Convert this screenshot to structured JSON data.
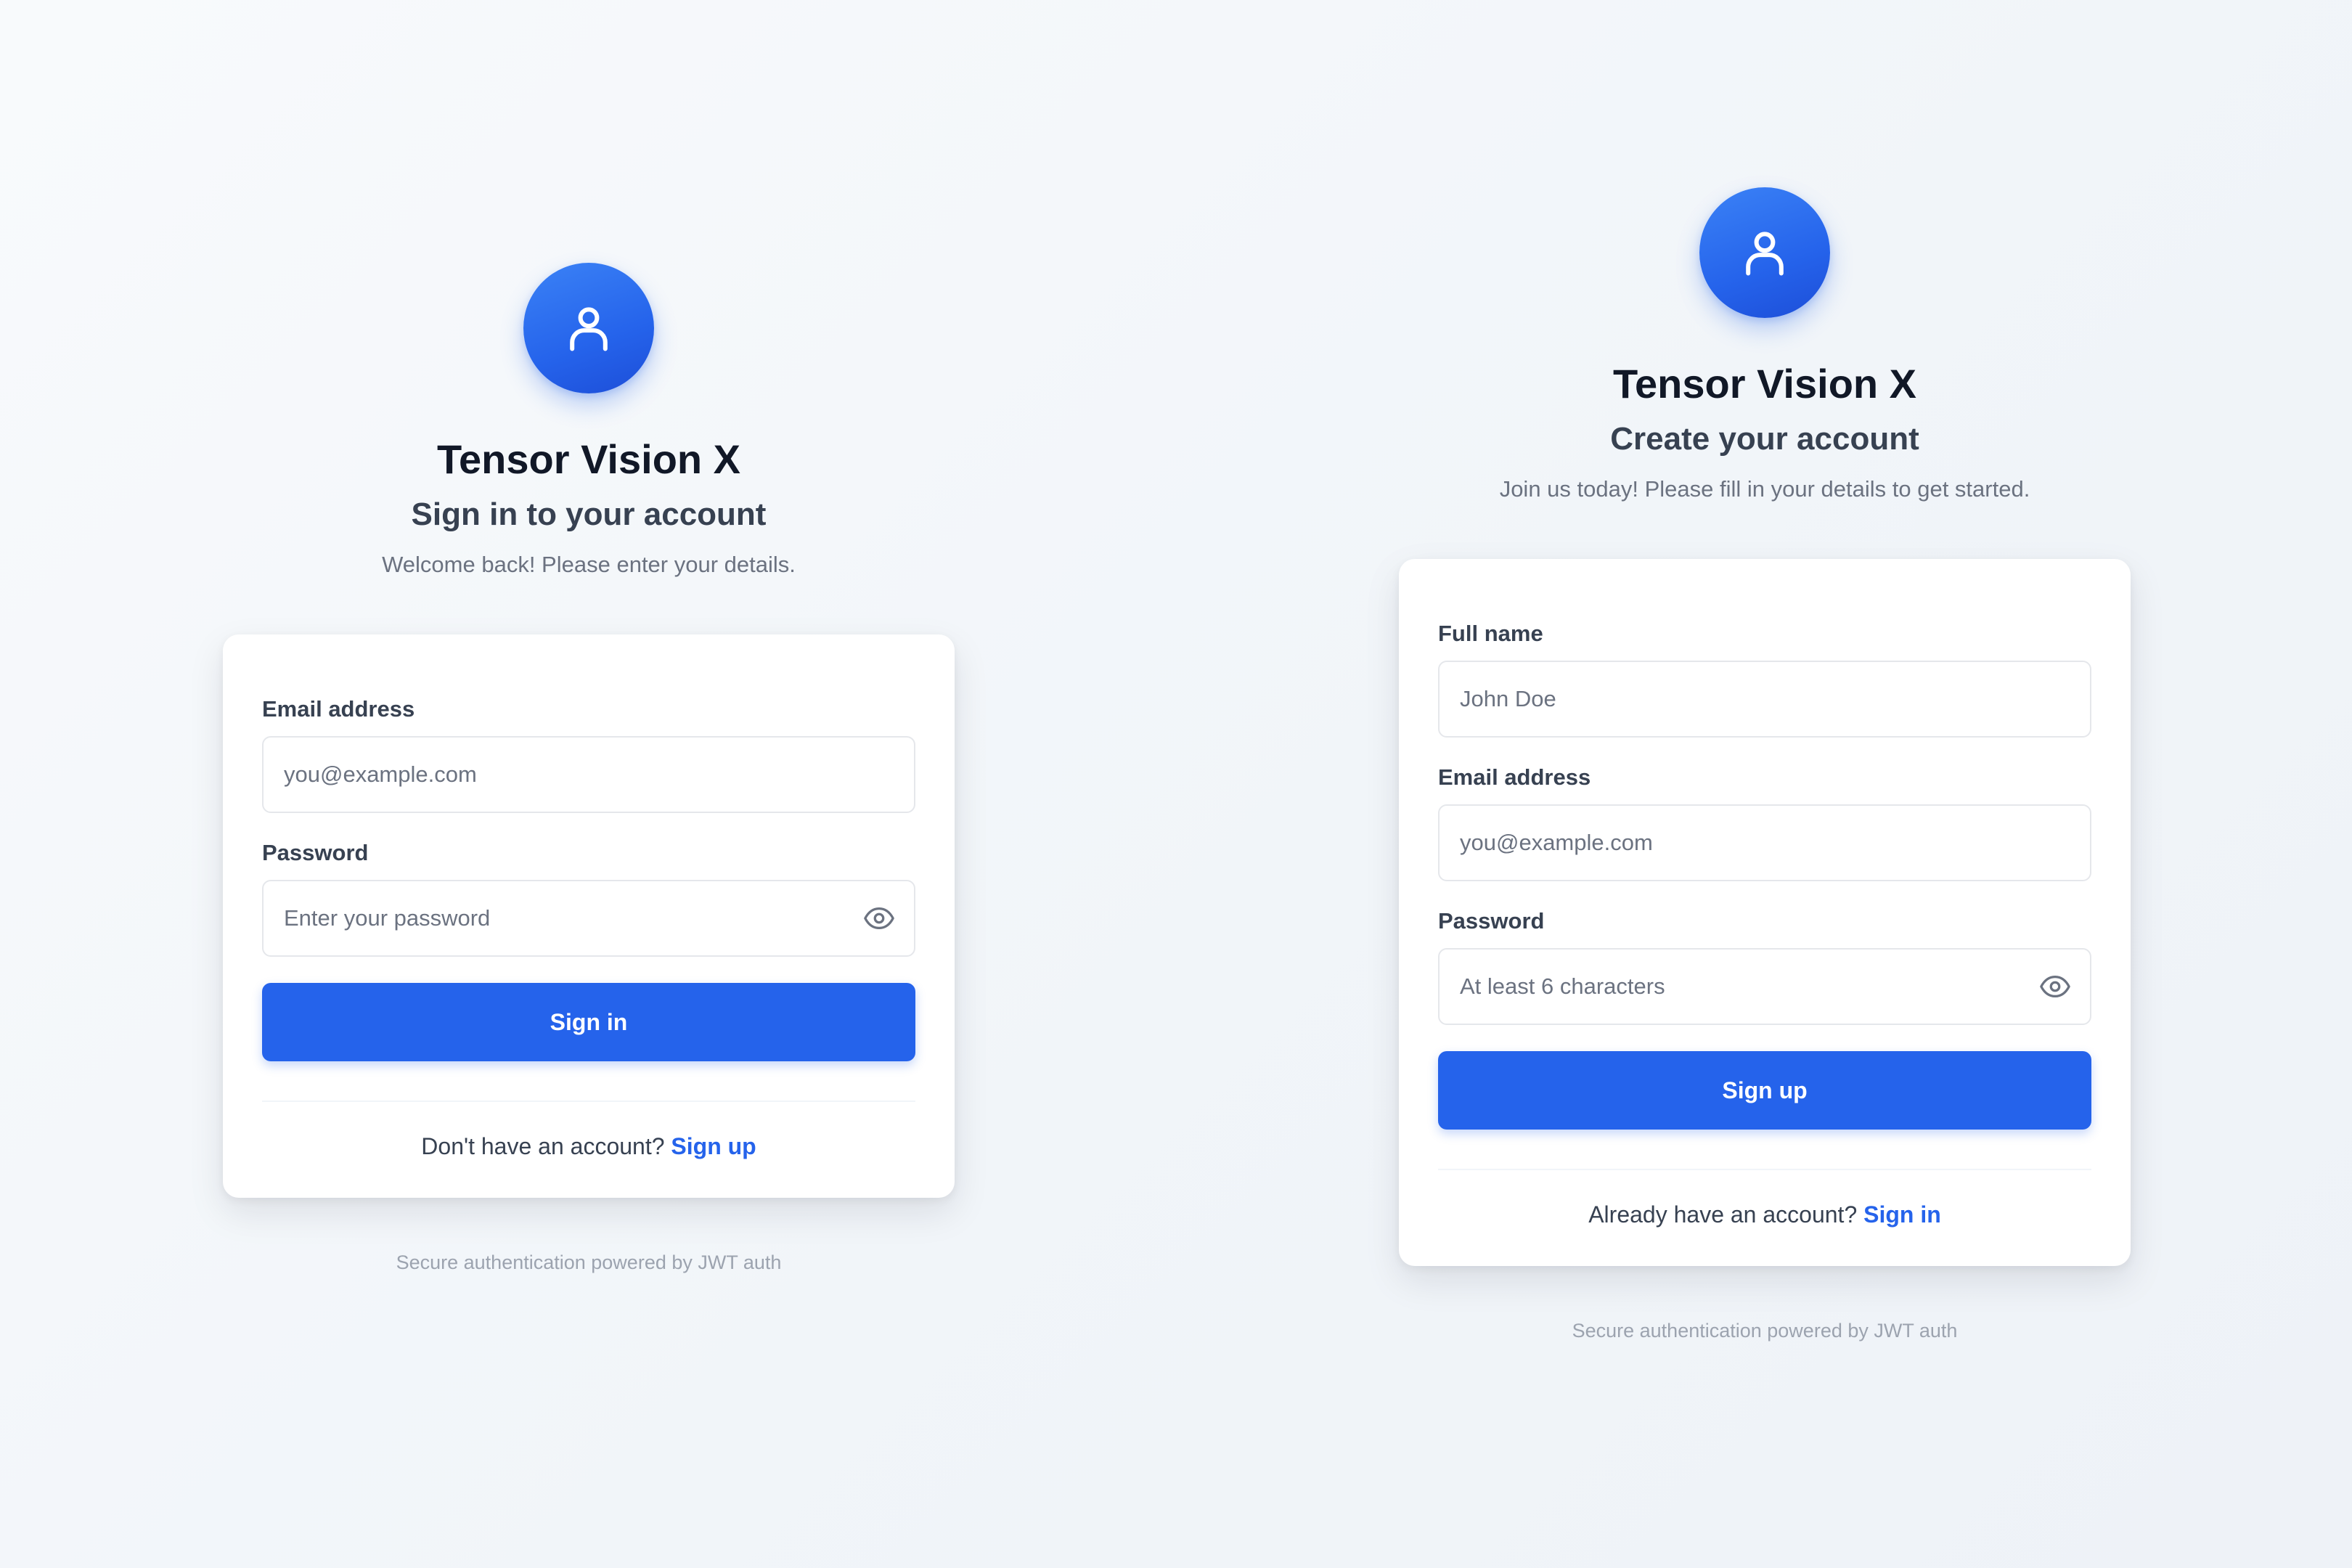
{
  "brand": {
    "app_name": "Tensor Vision X",
    "accent_color": "#2563eb",
    "avatar_icon": "user-icon"
  },
  "sign_in": {
    "heading": "Sign in to your account",
    "subheading": "Welcome back! Please enter your details.",
    "email": {
      "label": "Email address",
      "placeholder": "you@example.com",
      "value": ""
    },
    "password": {
      "label": "Password",
      "placeholder": "Enter your password",
      "value": "",
      "toggle_icon": "eye-icon"
    },
    "submit_label": "Sign in",
    "switch_prompt": "Don't have an account?",
    "switch_link": "Sign up",
    "footer": "Secure authentication powered by JWT auth"
  },
  "sign_up": {
    "heading": "Create your account",
    "subheading": "Join us today! Please fill in your details to get started.",
    "full_name": {
      "label": "Full name",
      "placeholder": "John Doe",
      "value": ""
    },
    "email": {
      "label": "Email address",
      "placeholder": "you@example.com",
      "value": ""
    },
    "password": {
      "label": "Password",
      "placeholder": "At least 6 characters",
      "value": "",
      "toggle_icon": "eye-icon"
    },
    "submit_label": "Sign up",
    "switch_prompt": "Already have an account?",
    "switch_link": "Sign in",
    "footer": "Secure authentication powered by JWT auth"
  }
}
